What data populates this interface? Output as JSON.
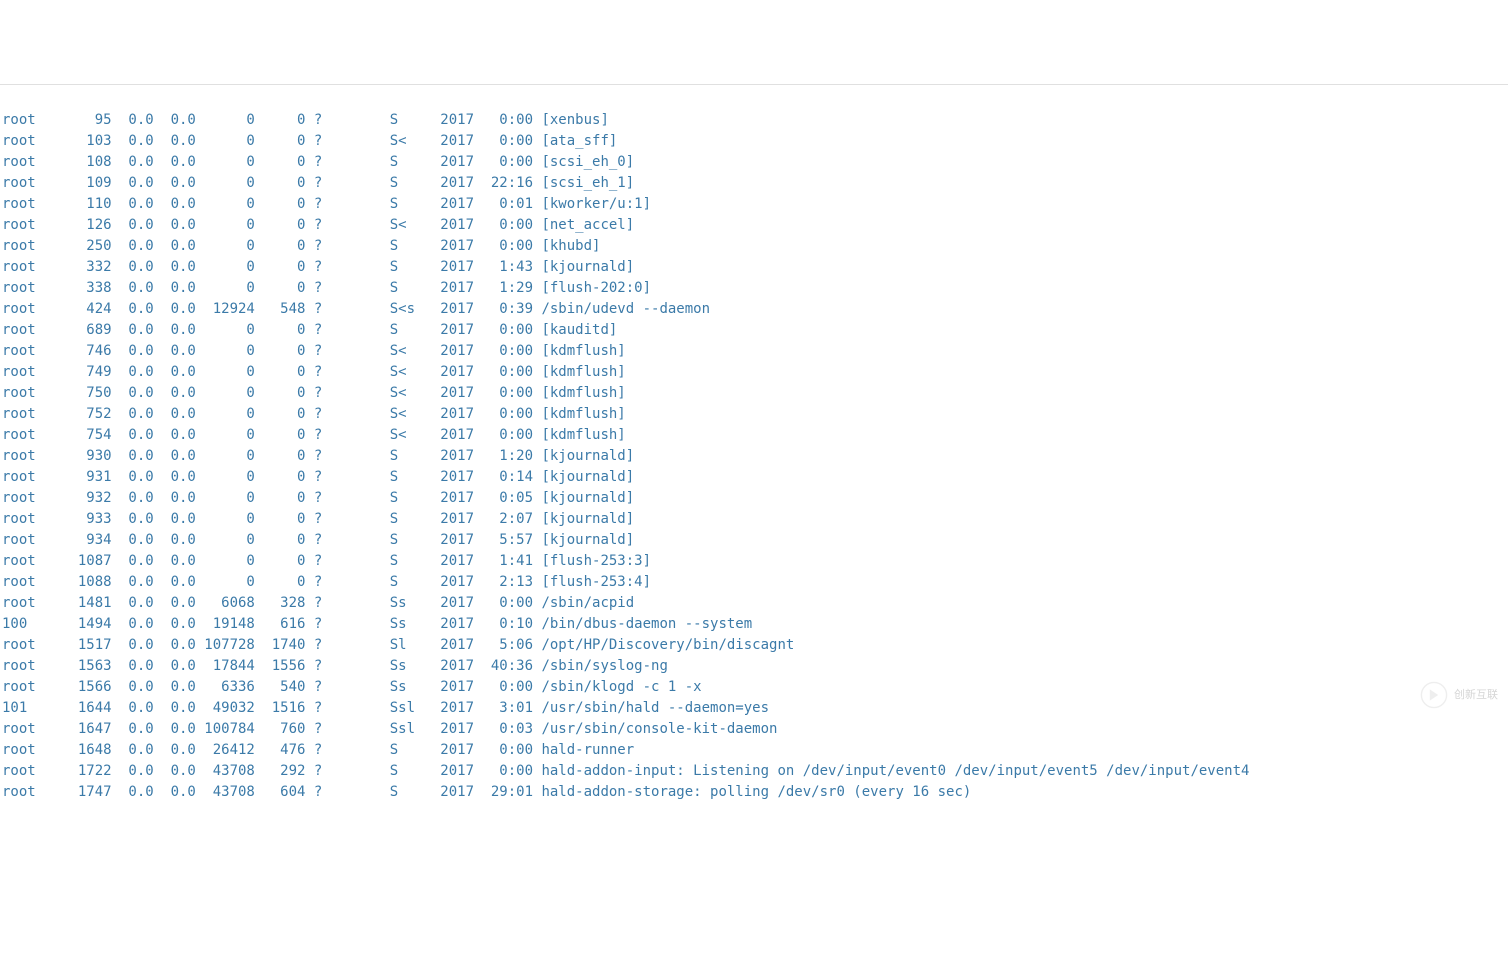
{
  "processes": [
    {
      "user": "root",
      "pid": "95",
      "cpu": "0.0",
      "mem": "0.0",
      "vsz": "0",
      "rss": "0",
      "tty": "?",
      "stat": "S",
      "start": "2017",
      "time": "0:00",
      "command": "[xenbus]"
    },
    {
      "user": "root",
      "pid": "103",
      "cpu": "0.0",
      "mem": "0.0",
      "vsz": "0",
      "rss": "0",
      "tty": "?",
      "stat": "S<",
      "start": "2017",
      "time": "0:00",
      "command": "[ata_sff]"
    },
    {
      "user": "root",
      "pid": "108",
      "cpu": "0.0",
      "mem": "0.0",
      "vsz": "0",
      "rss": "0",
      "tty": "?",
      "stat": "S",
      "start": "2017",
      "time": "0:00",
      "command": "[scsi_eh_0]"
    },
    {
      "user": "root",
      "pid": "109",
      "cpu": "0.0",
      "mem": "0.0",
      "vsz": "0",
      "rss": "0",
      "tty": "?",
      "stat": "S",
      "start": "2017",
      "time": "22:16",
      "command": "[scsi_eh_1]"
    },
    {
      "user": "root",
      "pid": "110",
      "cpu": "0.0",
      "mem": "0.0",
      "vsz": "0",
      "rss": "0",
      "tty": "?",
      "stat": "S",
      "start": "2017",
      "time": "0:01",
      "command": "[kworker/u:1]"
    },
    {
      "user": "root",
      "pid": "126",
      "cpu": "0.0",
      "mem": "0.0",
      "vsz": "0",
      "rss": "0",
      "tty": "?",
      "stat": "S<",
      "start": "2017",
      "time": "0:00",
      "command": "[net_accel]"
    },
    {
      "user": "root",
      "pid": "250",
      "cpu": "0.0",
      "mem": "0.0",
      "vsz": "0",
      "rss": "0",
      "tty": "?",
      "stat": "S",
      "start": "2017",
      "time": "0:00",
      "command": "[khubd]"
    },
    {
      "user": "root",
      "pid": "332",
      "cpu": "0.0",
      "mem": "0.0",
      "vsz": "0",
      "rss": "0",
      "tty": "?",
      "stat": "S",
      "start": "2017",
      "time": "1:43",
      "command": "[kjournald]"
    },
    {
      "user": "root",
      "pid": "338",
      "cpu": "0.0",
      "mem": "0.0",
      "vsz": "0",
      "rss": "0",
      "tty": "?",
      "stat": "S",
      "start": "2017",
      "time": "1:29",
      "command": "[flush-202:0]"
    },
    {
      "user": "root",
      "pid": "424",
      "cpu": "0.0",
      "mem": "0.0",
      "vsz": "12924",
      "rss": "548",
      "tty": "?",
      "stat": "S<s",
      "start": "2017",
      "time": "0:39",
      "command": "/sbin/udevd --daemon"
    },
    {
      "user": "root",
      "pid": "689",
      "cpu": "0.0",
      "mem": "0.0",
      "vsz": "0",
      "rss": "0",
      "tty": "?",
      "stat": "S",
      "start": "2017",
      "time": "0:00",
      "command": "[kauditd]"
    },
    {
      "user": "root",
      "pid": "746",
      "cpu": "0.0",
      "mem": "0.0",
      "vsz": "0",
      "rss": "0",
      "tty": "?",
      "stat": "S<",
      "start": "2017",
      "time": "0:00",
      "command": "[kdmflush]"
    },
    {
      "user": "root",
      "pid": "749",
      "cpu": "0.0",
      "mem": "0.0",
      "vsz": "0",
      "rss": "0",
      "tty": "?",
      "stat": "S<",
      "start": "2017",
      "time": "0:00",
      "command": "[kdmflush]"
    },
    {
      "user": "root",
      "pid": "750",
      "cpu": "0.0",
      "mem": "0.0",
      "vsz": "0",
      "rss": "0",
      "tty": "?",
      "stat": "S<",
      "start": "2017",
      "time": "0:00",
      "command": "[kdmflush]"
    },
    {
      "user": "root",
      "pid": "752",
      "cpu": "0.0",
      "mem": "0.0",
      "vsz": "0",
      "rss": "0",
      "tty": "?",
      "stat": "S<",
      "start": "2017",
      "time": "0:00",
      "command": "[kdmflush]"
    },
    {
      "user": "root",
      "pid": "754",
      "cpu": "0.0",
      "mem": "0.0",
      "vsz": "0",
      "rss": "0",
      "tty": "?",
      "stat": "S<",
      "start": "2017",
      "time": "0:00",
      "command": "[kdmflush]"
    },
    {
      "user": "root",
      "pid": "930",
      "cpu": "0.0",
      "mem": "0.0",
      "vsz": "0",
      "rss": "0",
      "tty": "?",
      "stat": "S",
      "start": "2017",
      "time": "1:20",
      "command": "[kjournald]"
    },
    {
      "user": "root",
      "pid": "931",
      "cpu": "0.0",
      "mem": "0.0",
      "vsz": "0",
      "rss": "0",
      "tty": "?",
      "stat": "S",
      "start": "2017",
      "time": "0:14",
      "command": "[kjournald]"
    },
    {
      "user": "root",
      "pid": "932",
      "cpu": "0.0",
      "mem": "0.0",
      "vsz": "0",
      "rss": "0",
      "tty": "?",
      "stat": "S",
      "start": "2017",
      "time": "0:05",
      "command": "[kjournald]"
    },
    {
      "user": "root",
      "pid": "933",
      "cpu": "0.0",
      "mem": "0.0",
      "vsz": "0",
      "rss": "0",
      "tty": "?",
      "stat": "S",
      "start": "2017",
      "time": "2:07",
      "command": "[kjournald]"
    },
    {
      "user": "root",
      "pid": "934",
      "cpu": "0.0",
      "mem": "0.0",
      "vsz": "0",
      "rss": "0",
      "tty": "?",
      "stat": "S",
      "start": "2017",
      "time": "5:57",
      "command": "[kjournald]"
    },
    {
      "user": "root",
      "pid": "1087",
      "cpu": "0.0",
      "mem": "0.0",
      "vsz": "0",
      "rss": "0",
      "tty": "?",
      "stat": "S",
      "start": "2017",
      "time": "1:41",
      "command": "[flush-253:3]"
    },
    {
      "user": "root",
      "pid": "1088",
      "cpu": "0.0",
      "mem": "0.0",
      "vsz": "0",
      "rss": "0",
      "tty": "?",
      "stat": "S",
      "start": "2017",
      "time": "2:13",
      "command": "[flush-253:4]"
    },
    {
      "user": "root",
      "pid": "1481",
      "cpu": "0.0",
      "mem": "0.0",
      "vsz": "6068",
      "rss": "328",
      "tty": "?",
      "stat": "Ss",
      "start": "2017",
      "time": "0:00",
      "command": "/sbin/acpid"
    },
    {
      "user": "100",
      "pid": "1494",
      "cpu": "0.0",
      "mem": "0.0",
      "vsz": "19148",
      "rss": "616",
      "tty": "?",
      "stat": "Ss",
      "start": "2017",
      "time": "0:10",
      "command": "/bin/dbus-daemon --system"
    },
    {
      "user": "root",
      "pid": "1517",
      "cpu": "0.0",
      "mem": "0.0",
      "vsz": "107728",
      "rss": "1740",
      "tty": "?",
      "stat": "Sl",
      "start": "2017",
      "time": "5:06",
      "command": "/opt/HP/Discovery/bin/discagnt"
    },
    {
      "user": "root",
      "pid": "1563",
      "cpu": "0.0",
      "mem": "0.0",
      "vsz": "17844",
      "rss": "1556",
      "tty": "?",
      "stat": "Ss",
      "start": "2017",
      "time": "40:36",
      "command": "/sbin/syslog-ng"
    },
    {
      "user": "root",
      "pid": "1566",
      "cpu": "0.0",
      "mem": "0.0",
      "vsz": "6336",
      "rss": "540",
      "tty": "?",
      "stat": "Ss",
      "start": "2017",
      "time": "0:00",
      "command": "/sbin/klogd -c 1 -x"
    },
    {
      "user": "101",
      "pid": "1644",
      "cpu": "0.0",
      "mem": "0.0",
      "vsz": "49032",
      "rss": "1516",
      "tty": "?",
      "stat": "Ssl",
      "start": "2017",
      "time": "3:01",
      "command": "/usr/sbin/hald --daemon=yes"
    },
    {
      "user": "root",
      "pid": "1647",
      "cpu": "0.0",
      "mem": "0.0",
      "vsz": "100784",
      "rss": "760",
      "tty": "?",
      "stat": "Ssl",
      "start": "2017",
      "time": "0:03",
      "command": "/usr/sbin/console-kit-daemon"
    },
    {
      "user": "root",
      "pid": "1648",
      "cpu": "0.0",
      "mem": "0.0",
      "vsz": "26412",
      "rss": "476",
      "tty": "?",
      "stat": "S",
      "start": "2017",
      "time": "0:00",
      "command": "hald-runner"
    },
    {
      "user": "root",
      "pid": "1722",
      "cpu": "0.0",
      "mem": "0.0",
      "vsz": "43708",
      "rss": "292",
      "tty": "?",
      "stat": "S",
      "start": "2017",
      "time": "0:00",
      "command": "hald-addon-input: Listening on /dev/input/event0 /dev/input/event5 /dev/input/event4"
    },
    {
      "user": "root",
      "pid": "1747",
      "cpu": "0.0",
      "mem": "0.0",
      "vsz": "43708",
      "rss": "604",
      "tty": "?",
      "stat": "S",
      "start": "2017",
      "time": "29:01",
      "command": "hald-addon-storage: polling /dev/sr0 (every 16 sec)"
    }
  ],
  "watermark": "创新互联"
}
